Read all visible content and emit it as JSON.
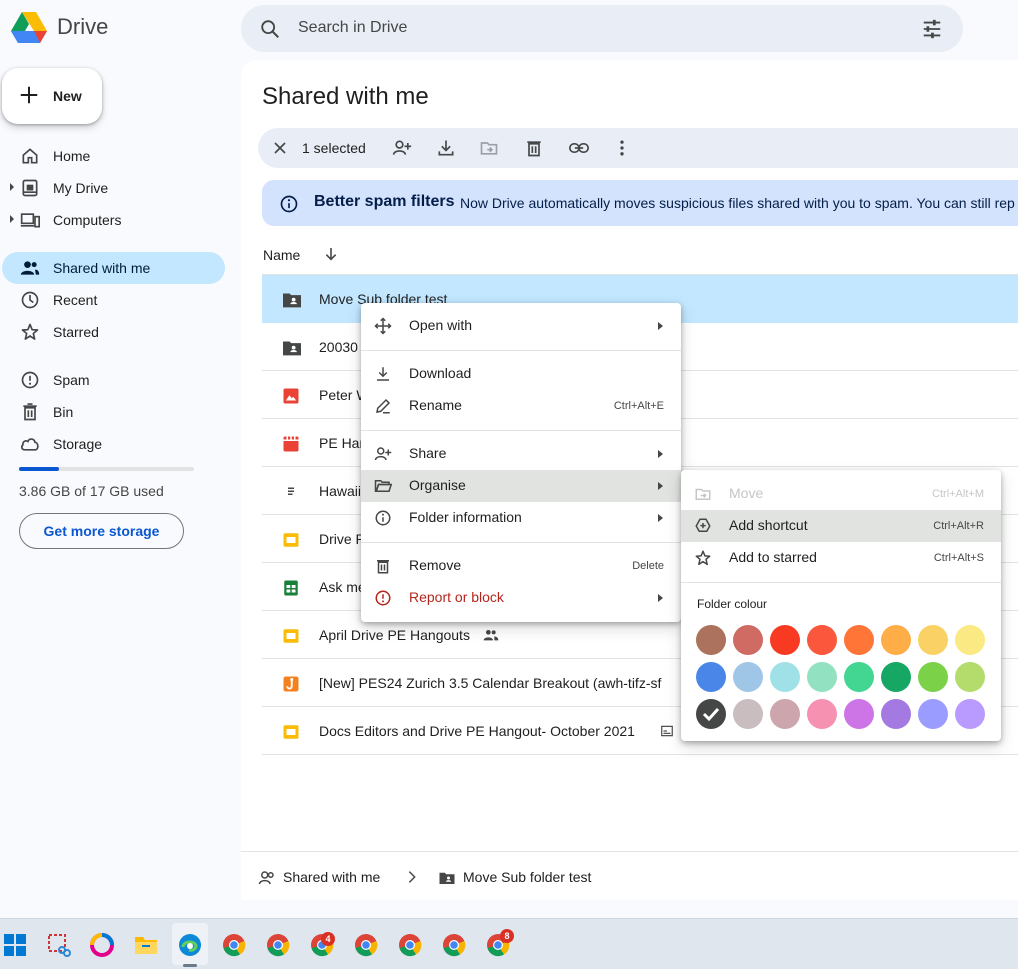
{
  "app": {
    "name": "Drive"
  },
  "search": {
    "placeholder": "Search in Drive"
  },
  "sidebar": {
    "new_label": "New",
    "items": [
      {
        "label": "Home",
        "icon": "home-icon"
      },
      {
        "label": "My Drive",
        "icon": "my-drive-icon"
      },
      {
        "label": "Computers",
        "icon": "computers-icon"
      },
      {
        "label": "Shared with me",
        "icon": "shared-icon"
      },
      {
        "label": "Recent",
        "icon": "clock-icon"
      },
      {
        "label": "Starred",
        "icon": "star-icon"
      },
      {
        "label": "Spam",
        "icon": "spam-icon"
      },
      {
        "label": "Bin",
        "icon": "trash-icon"
      },
      {
        "label": "Storage",
        "icon": "cloud-icon"
      }
    ],
    "storage_used_fraction": 0.227,
    "storage_text": "3.86 GB of 17 GB used",
    "get_more_label": "Get more storage"
  },
  "main": {
    "title": "Shared with me",
    "selection": {
      "count_label": "1 selected"
    },
    "banner": {
      "title": "Better spam filters",
      "text": "Now Drive automatically moves suspicious files shared with you to spam. You can still rep"
    },
    "column_name": "Name",
    "files": [
      {
        "name": "Move Sub folder test",
        "icon": "shared-folder-icon",
        "color": "#444746"
      },
      {
        "name": "20030",
        "icon": "shared-folder-icon",
        "color": "#444746"
      },
      {
        "name": "Peter W",
        "icon": "image-icon",
        "color": "#ea4335"
      },
      {
        "name": "PE Har",
        "icon": "video-icon",
        "color": "#ea4335"
      },
      {
        "name": "Hawaii",
        "icon": "document-icon",
        "color": "#444746"
      },
      {
        "name": "Drive P",
        "icon": "slides-icon",
        "color": "#fbbc04"
      },
      {
        "name": "Ask me",
        "icon": "sheets-icon",
        "color": "#188038"
      },
      {
        "name": "April Drive PE Hangouts",
        "icon": "slides-icon",
        "color": "#fbbc04"
      },
      {
        "name": "[New] PES24 Zurich 3.5 Calendar Breakout (awh-tifz-sf",
        "icon": "jamboard-icon",
        "color": "#f4811f"
      },
      {
        "name": "Docs Editors and Drive PE Hangout- October 2021",
        "icon": "slides-icon",
        "color": "#fbbc04"
      }
    ]
  },
  "breadcrumb": {
    "root": "Shared with me",
    "current": "Move Sub folder test"
  },
  "context_menu": {
    "items": [
      {
        "label": "Open with",
        "shortcut": ""
      },
      {
        "label": "Download",
        "shortcut": ""
      },
      {
        "label": "Rename",
        "shortcut": "Ctrl+Alt+E"
      },
      {
        "label": "Share",
        "shortcut": ""
      },
      {
        "label": "Organise",
        "shortcut": ""
      },
      {
        "label": "Folder information",
        "shortcut": ""
      },
      {
        "label": "Remove",
        "shortcut": "Delete"
      },
      {
        "label": "Report or block",
        "shortcut": ""
      }
    ]
  },
  "submenu": {
    "items": [
      {
        "label": "Move",
        "shortcut": "Ctrl+Alt+M"
      },
      {
        "label": "Add shortcut",
        "shortcut": "Ctrl+Alt+R"
      },
      {
        "label": "Add to starred",
        "shortcut": "Ctrl+Alt+S"
      }
    ],
    "folder_colour_label": "Folder colour",
    "colours": [
      "#ac725e",
      "#d06b64",
      "#f83a22",
      "#fa573c",
      "#ff7537",
      "#ffad46",
      "#fad165",
      "#fbe983",
      "#4986e7",
      "#9fc6e7",
      "#9fe1e7",
      "#92e1c0",
      "#42d692",
      "#16a765",
      "#7bd148",
      "#b3dc6c",
      "#444746",
      "#cabdbf",
      "#cca6ac",
      "#f691b2",
      "#cd74e6",
      "#a47ae2",
      "#9a9cff",
      "#b99aff"
    ]
  },
  "taskbar": {
    "badge_a": "4",
    "badge_b": "8"
  }
}
